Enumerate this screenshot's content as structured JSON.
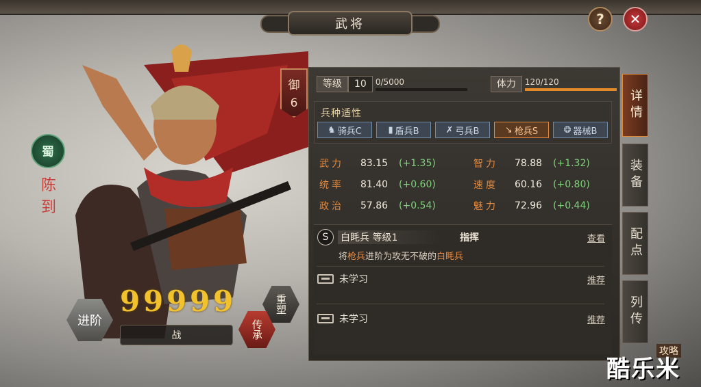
{
  "window": {
    "title": "武将"
  },
  "controls": {
    "help": "?",
    "close": "✕"
  },
  "hero": {
    "faction": "蜀",
    "name": "陈到",
    "troop_badge": {
      "label": "御",
      "value": "6"
    },
    "stars": [
      "9",
      "9",
      "9",
      "9",
      "9"
    ],
    "advance_label": "进阶",
    "battle_label": "战",
    "remodel_label": "重塑",
    "inherit_label": "传承"
  },
  "stats": {
    "level_label": "等级",
    "level": "10",
    "exp_text": "0/5000",
    "exp_progress": 0.0,
    "stamina_label": "体力",
    "stamina_text": "120/120",
    "stamina_progress": 1.0
  },
  "troops": {
    "title": "兵种适性",
    "items": [
      {
        "icon": "cavalry-icon",
        "glyph": "♞",
        "label": "骑兵C"
      },
      {
        "icon": "shield-icon",
        "glyph": "▮",
        "label": "盾兵B"
      },
      {
        "icon": "bow-icon",
        "glyph": "✗",
        "label": "弓兵B"
      },
      {
        "icon": "spear-icon",
        "glyph": "↘",
        "label": "枪兵S"
      },
      {
        "icon": "machine-icon",
        "glyph": "❂",
        "label": "器械B"
      }
    ]
  },
  "attributes": [
    {
      "name": "武力",
      "value": "83.15",
      "bonus": "(+1.35)"
    },
    {
      "name": "智力",
      "value": "78.88",
      "bonus": "(+1.32)"
    },
    {
      "name": "统率",
      "value": "81.40",
      "bonus": "(+0.60)"
    },
    {
      "name": "速度",
      "value": "60.16",
      "bonus": "(+0.80)"
    },
    {
      "name": "政治",
      "value": "57.86",
      "bonus": "(+0.54)"
    },
    {
      "name": "魅力",
      "value": "72.96",
      "bonus": "(+0.44)"
    }
  ],
  "skills": {
    "main": {
      "badge": "S",
      "name": "白眊兵 等级1",
      "type": "指挥",
      "link": "查看",
      "desc_prefix": "将",
      "desc_hl1": "枪兵",
      "desc_mid": "进阶为攻无不破的",
      "desc_hl2": "白眊兵"
    },
    "slot1": {
      "label": "未学习",
      "link": "推荐"
    },
    "slot2": {
      "label": "未学习",
      "link": "推荐"
    }
  },
  "tabs": [
    "详情",
    "装备",
    "配点",
    "列传"
  ],
  "footer": {
    "strategy": "攻略",
    "watermark": "酷乐米"
  },
  "colors": {
    "accent": "#e08a2e",
    "faction": "#2f6e4a",
    "name": "#c8413a",
    "bonus": "#7ed47a"
  }
}
